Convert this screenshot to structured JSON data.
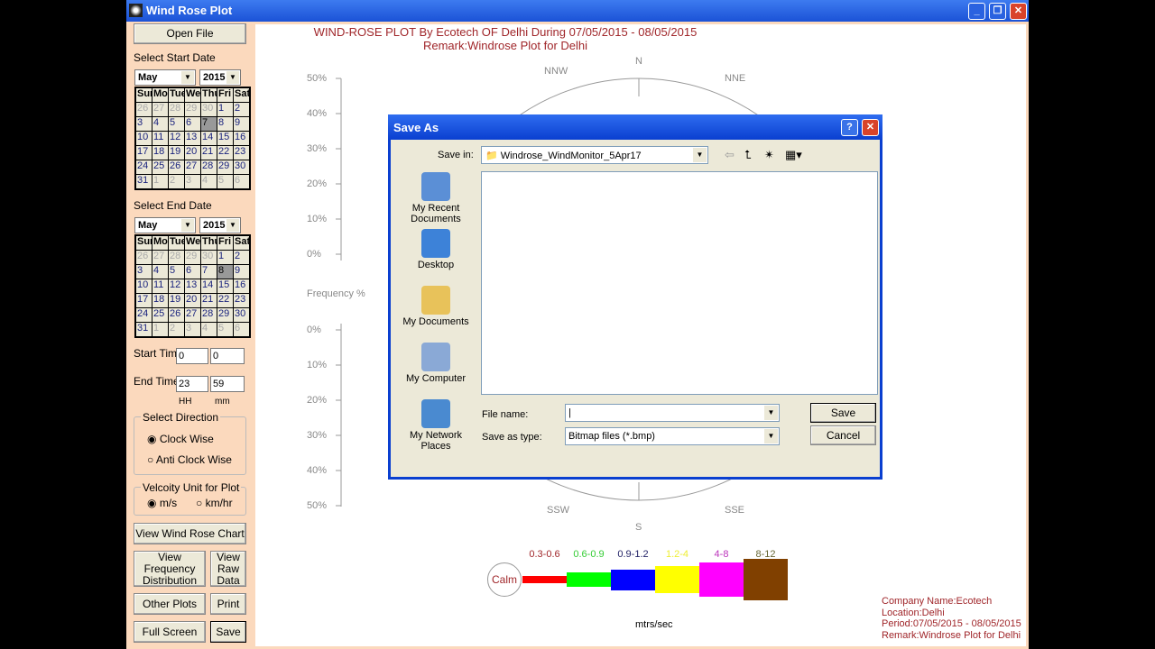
{
  "window": {
    "title": "Wind Rose Plot",
    "controls": [
      "minimize",
      "restore",
      "close"
    ]
  },
  "sidebar": {
    "open_file": "Open File",
    "start_label": "Select Start Date",
    "end_label": "Select End Date",
    "start_month": "May",
    "start_year": "2015",
    "end_month": "May",
    "end_year": "2015",
    "weekdays": [
      "Sun",
      "Mon",
      "Tue",
      "Wed",
      "Thu",
      "Fri",
      "Sat"
    ],
    "calendar_days": [
      "26",
      "27",
      "28",
      "29",
      "30",
      "1",
      "2",
      "3",
      "4",
      "5",
      "6",
      "7",
      "8",
      "9",
      "10",
      "11",
      "12",
      "13",
      "14",
      "15",
      "16",
      "17",
      "18",
      "19",
      "20",
      "21",
      "22",
      "23",
      "24",
      "25",
      "26",
      "27",
      "28",
      "29",
      "30",
      "31",
      "1",
      "2",
      "3",
      "4",
      "5",
      "6"
    ],
    "start_selected": "7",
    "end_selected": "8",
    "start_time_label": "Start Time",
    "start_hh": "0",
    "start_mm": "0",
    "end_time_label": "End Time",
    "end_hh": "23",
    "end_mm": "59",
    "hh": "HH",
    "mm": "mm",
    "direction_label": "Select Direction",
    "clockwise": "Clock Wise",
    "anticlockwise": "Anti Clock Wise",
    "direction_selected": "Clock Wise",
    "velocity_label": "Velcoity Unit for Plot",
    "ms": "m/s",
    "kmhr": "km/hr",
    "velocity_selected": "m/s",
    "view_chart": "View Wind Rose Chart",
    "view_freq": "View Frequency Distribution",
    "view_raw": "View Raw Data",
    "other_plots": "Other Plots",
    "print": "Print",
    "full_screen": "Full Screen",
    "save": "Save"
  },
  "plot": {
    "title": "WIND-ROSE PLOT By Ecotech OF Delhi During 07/05/2015 - 08/05/2015",
    "remark": "Remark:Windrose Plot for Delhi",
    "directions": {
      "N": "N",
      "NNE": "NNE",
      "NNW": "NNW",
      "S": "S",
      "SSE": "SSE",
      "SSW": "SSW"
    },
    "freq_ticks_top": [
      "50%",
      "40%",
      "30%",
      "20%",
      "10%",
      "0%"
    ],
    "freq_ticks_bottom": [
      "0%",
      "10%",
      "20%",
      "30%",
      "40%",
      "50%"
    ],
    "freq_label": "Frequency %",
    "legend": {
      "calm": "Calm",
      "unit": "mtrs/sec",
      "bins": [
        {
          "label": "0.3-0.6",
          "color": "#ff0000"
        },
        {
          "label": "0.6-0.9",
          "color": "#00ff00"
        },
        {
          "label": "0.9-1.2",
          "color": "#0000ff"
        },
        {
          "label": "1.2-4",
          "color": "#ffff00"
        },
        {
          "label": "4-8",
          "color": "#ff00ff"
        },
        {
          "label": "8-12",
          "color": "#804000"
        }
      ]
    },
    "info": [
      "Company Name:Ecotech",
      "Location:Delhi",
      "Period:07/05/2015 - 08/05/2015",
      "Remark:Windrose Plot for Delhi"
    ]
  },
  "dialog": {
    "title": "Save As",
    "save_in_label": "Save in:",
    "save_in": "Windrose_WindMonitor_5Apr17",
    "places": [
      "My Recent Documents",
      "Desktop",
      "My Documents",
      "My Computer",
      "My Network Places"
    ],
    "file_name_label": "File name:",
    "file_name": "",
    "type_label": "Save as type:",
    "type": "Bitmap files (*.bmp)",
    "save": "Save",
    "cancel": "Cancel"
  }
}
